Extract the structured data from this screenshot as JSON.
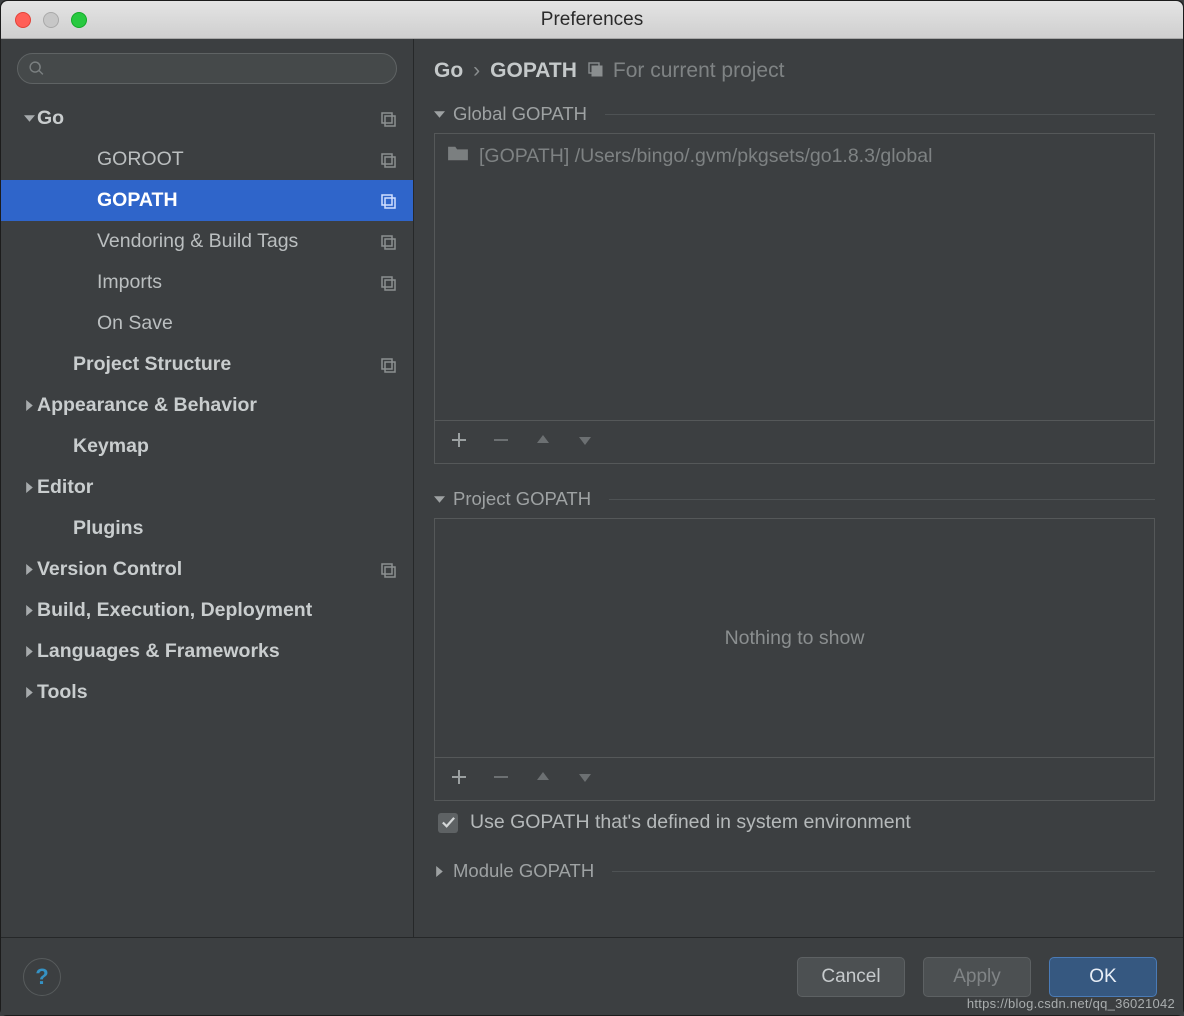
{
  "title": "Preferences",
  "sidebar": {
    "search_placeholder": "",
    "items": [
      {
        "label": "Go",
        "level": "ind0",
        "bold": true,
        "arrow": "down",
        "copy": true
      },
      {
        "label": "GOROOT",
        "level": "ind1-sub",
        "copy": true
      },
      {
        "label": "GOPATH",
        "level": "ind1-sub",
        "copy": true,
        "selected": true
      },
      {
        "label": "Vendoring & Build Tags",
        "level": "ind1-sub",
        "copy": true
      },
      {
        "label": "Imports",
        "level": "ind1-sub",
        "copy": true
      },
      {
        "label": "On Save",
        "level": "ind1-sub"
      },
      {
        "label": "Project Structure",
        "level": "ind1b",
        "bold": true,
        "copy": true
      },
      {
        "label": "Appearance & Behavior",
        "level": "ind0",
        "bold": true,
        "arrow": "right"
      },
      {
        "label": "Keymap",
        "level": "ind1b",
        "bold": true
      },
      {
        "label": "Editor",
        "level": "ind0",
        "bold": true,
        "arrow": "right"
      },
      {
        "label": "Plugins",
        "level": "ind1b",
        "bold": true
      },
      {
        "label": "Version Control",
        "level": "ind0",
        "bold": true,
        "arrow": "right",
        "copy": true
      },
      {
        "label": "Build, Execution, Deployment",
        "level": "ind0",
        "bold": true,
        "arrow": "right"
      },
      {
        "label": "Languages & Frameworks",
        "level": "ind0",
        "bold": true,
        "arrow": "right"
      },
      {
        "label": "Tools",
        "level": "ind0",
        "bold": true,
        "arrow": "right"
      }
    ]
  },
  "breadcrumb": {
    "root": "Go",
    "sep": "›",
    "current": "GOPATH",
    "scope": "For current project"
  },
  "sections": {
    "global": {
      "title": "Global GOPATH",
      "items": [
        "[GOPATH] /Users/bingo/.gvm/pkgsets/go1.8.3/global"
      ]
    },
    "project": {
      "title": "Project GOPATH",
      "empty_text": "Nothing to show"
    },
    "module": {
      "title": "Module GOPATH"
    },
    "use_system": "Use GOPATH that's defined in system environment"
  },
  "footer": {
    "cancel": "Cancel",
    "apply": "Apply",
    "ok": "OK"
  },
  "watermark": "https://blog.csdn.net/qq_36021042"
}
